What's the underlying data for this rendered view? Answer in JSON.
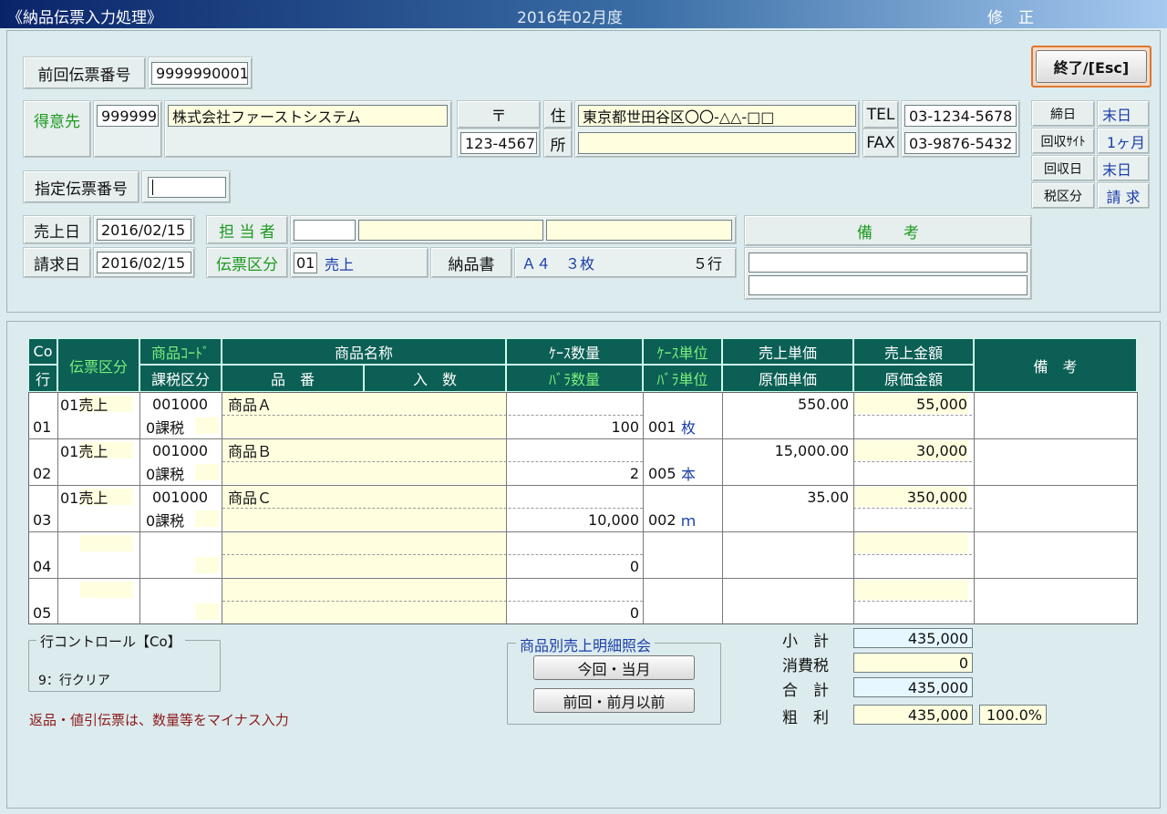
{
  "window": {
    "title": "《納品伝票入力処理》",
    "period": "2016年02月度",
    "mode": "修　正"
  },
  "header": {
    "prev_slip_label": "前回伝票番号",
    "prev_slip_value": "9999990001",
    "exit_button": "終了/[Esc]",
    "customer_label": "得意先",
    "customer_code": "999999",
    "customer_name": "株式会社ファーストシステム",
    "postal_label": "〒",
    "postal_value": "123-4567",
    "address_label_1": "住",
    "address_label_2": "所",
    "address_line1": "東京都世田谷区〇〇-△△-□□",
    "address_line2": "",
    "tel_label": "TEL",
    "tel_value": "03-1234-5678",
    "fax_label": "FAX",
    "fax_value": "03-9876-5432",
    "closing_label": "締日",
    "closing_value": "末日",
    "collect_site_label": "回収ｻｲﾄ",
    "collect_site_value": "1ヶ月",
    "collect_day_label": "回収日",
    "collect_day_value": "末日",
    "tax_class_label": "税区分",
    "tax_class_value": "請 求",
    "slip_no_label": "指定伝票番号",
    "slip_no_value": "",
    "sales_date_label": "売上日",
    "sales_date_value": "2016/02/15",
    "bill_date_label": "請求日",
    "bill_date_value": "2016/02/15",
    "staff_label": "担 当 者",
    "slip_type_label": "伝票区分",
    "slip_type_code": "01",
    "slip_type_name": "売上",
    "delivery_label": "納品書",
    "delivery_paper": "Ａ４　３枚",
    "delivery_lines": "５行",
    "remarks_label": "備　　考"
  },
  "grid": {
    "headers": {
      "co": "Co",
      "row": "行",
      "slip_type": "伝票区分",
      "item_code": "商品ｺｰﾄﾞ",
      "tax_class": "課税区分",
      "item_name": "商品名称",
      "part_no": "品　番",
      "qty_per": "入　数",
      "case_qty": "ｹｰｽ数量",
      "piece_qty": "ﾊﾞﾗ数量",
      "case_unit": "ｹｰｽ単位",
      "piece_unit": "ﾊﾞﾗ単位",
      "sale_price": "売上単価",
      "cost_price": "原価単価",
      "sale_amount": "売上金額",
      "cost_amount": "原価金額",
      "remarks": "備　考"
    },
    "rows": [
      {
        "no": "01",
        "slip_type": "01売上",
        "item_code": "001000",
        "tax": "0課税",
        "name": "商品Ａ",
        "piece_qty": "100",
        "unit_code": "001",
        "unit_name": "枚",
        "price": "550.00",
        "amount": "55,000"
      },
      {
        "no": "02",
        "slip_type": "01売上",
        "item_code": "001000",
        "tax": "0課税",
        "name": "商品Ｂ",
        "piece_qty": "2",
        "unit_code": "005",
        "unit_name": "本",
        "price": "15,000.00",
        "amount": "30,000"
      },
      {
        "no": "03",
        "slip_type": "01売上",
        "item_code": "001000",
        "tax": "0課税",
        "name": "商品Ｃ",
        "piece_qty": "10,000",
        "unit_code": "002",
        "unit_name": "ｍ",
        "price": "35.00",
        "amount": "350,000"
      },
      {
        "no": "04",
        "slip_type": "",
        "item_code": "",
        "tax": "",
        "name": "",
        "piece_qty": "0",
        "unit_code": "",
        "unit_name": "",
        "price": "",
        "amount": ""
      },
      {
        "no": "05",
        "slip_type": "",
        "item_code": "",
        "tax": "",
        "name": "",
        "piece_qty": "0",
        "unit_code": "",
        "unit_name": "",
        "price": "",
        "amount": ""
      }
    ]
  },
  "footer": {
    "row_control_title": "行コントロール【Co】",
    "row_control_item": "9：行クリア",
    "return_note": "返品・値引伝票は、数量等をマイナス入力",
    "inquiry_title": "商品別売上明細照会",
    "btn_current": "今回・当月",
    "btn_previous": "前回・前月以前",
    "subtotal_label": "小　計",
    "subtotal": "435,000",
    "tax_label": "消費税",
    "tax": "0",
    "total_label": "合　計",
    "total": "435,000",
    "profit_label": "粗　利",
    "profit": "435,000",
    "profit_rate": "100.0%"
  },
  "colors": {
    "header_green": "#0b5f54",
    "label_green": "#1e9a1e",
    "value_blue": "#1a3ea8",
    "note_red": "#8b1a1a"
  }
}
